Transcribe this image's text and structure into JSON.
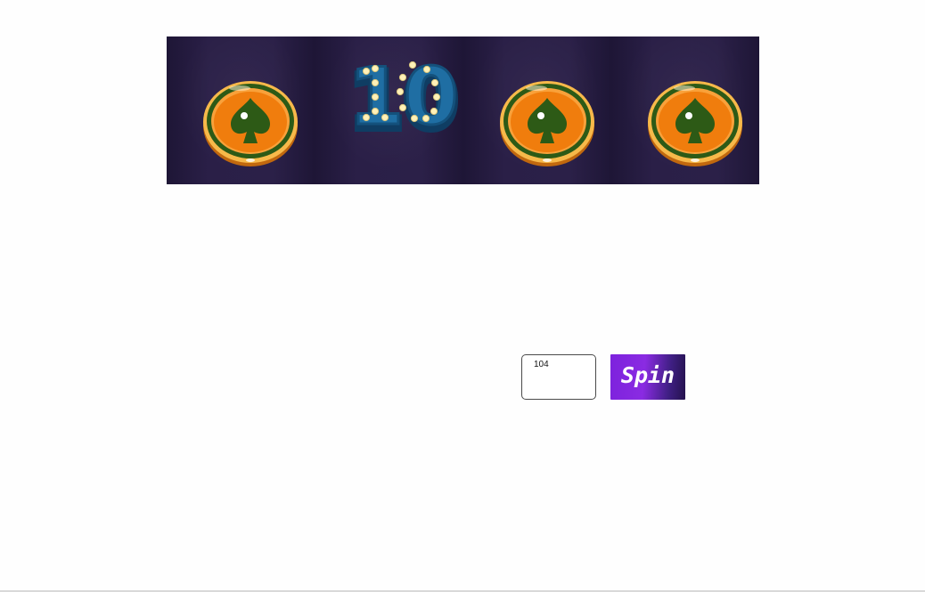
{
  "reels": [
    {
      "symbol": "spade-coin-icon"
    },
    {
      "symbol": "number-ten-icon",
      "text": "10"
    },
    {
      "symbol": "spade-coin-icon"
    },
    {
      "symbol": "spade-coin-icon"
    }
  ],
  "bet_input": {
    "value": "104"
  },
  "spin_button": {
    "label": "Spin"
  },
  "colors": {
    "reel_background": "#24193e",
    "spin_gradient_start": "#7d22dd",
    "spin_gradient_end": "#24124d",
    "coin_orange": "#f07d0d",
    "coin_green": "#2d5a16",
    "ten_blue": "#1f5f8b"
  }
}
